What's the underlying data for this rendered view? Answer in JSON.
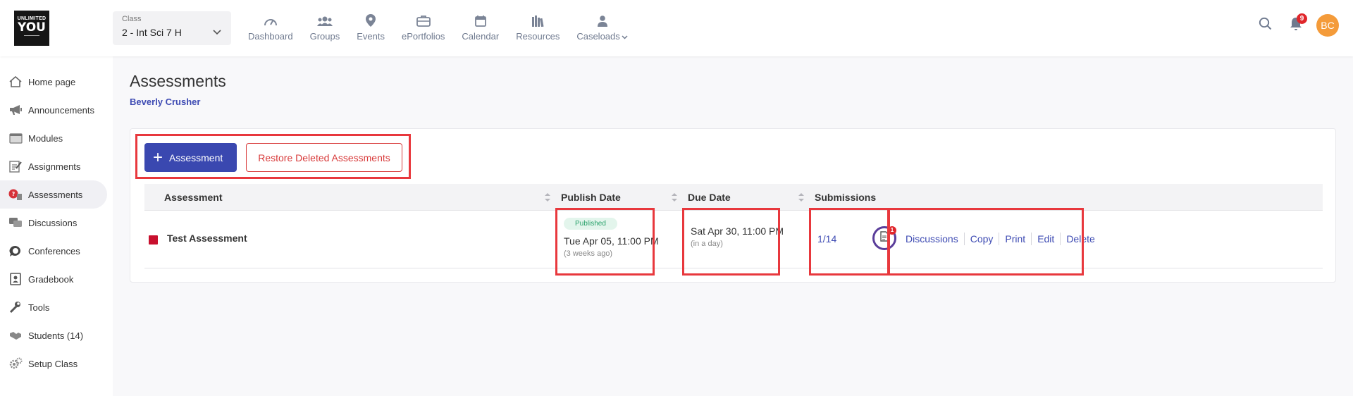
{
  "logo": {
    "line1": "UNLIMITED",
    "line2": "YOU"
  },
  "class_select": {
    "label": "Class",
    "value": "2 - Int Sci 7 H"
  },
  "topnav": [
    {
      "label": "Dashboard",
      "icon": "gauge-icon"
    },
    {
      "label": "Groups",
      "icon": "users-icon"
    },
    {
      "label": "Events",
      "icon": "map-pin-icon"
    },
    {
      "label": "ePortfolios",
      "icon": "briefcase-icon"
    },
    {
      "label": "Calendar",
      "icon": "calendar-icon"
    },
    {
      "label": "Resources",
      "icon": "books-icon"
    },
    {
      "label": "Caseloads",
      "icon": "person-icon"
    }
  ],
  "notifications": {
    "count": "9"
  },
  "user": {
    "initials": "BC"
  },
  "sidebar": [
    {
      "label": "Home page",
      "icon": "home-icon"
    },
    {
      "label": "Announcements",
      "icon": "megaphone-icon"
    },
    {
      "label": "Modules",
      "icon": "folder-icon"
    },
    {
      "label": "Assignments",
      "icon": "assignment-icon"
    },
    {
      "label": "Assessments",
      "icon": "assessment-icon",
      "active": true
    },
    {
      "label": "Discussions",
      "icon": "discussion-icon"
    },
    {
      "label": "Conferences",
      "icon": "chat-bubble-icon"
    },
    {
      "label": "Gradebook",
      "icon": "gradebook-icon"
    },
    {
      "label": "Tools",
      "icon": "wrench-icon"
    },
    {
      "label": "Students (14)",
      "icon": "handshake-icon"
    },
    {
      "label": "Setup Class",
      "icon": "gears-icon"
    }
  ],
  "page": {
    "title": "Assessments",
    "teacher": "Beverly Crusher"
  },
  "toolbar": {
    "add_label": "Assessment",
    "restore_label": "Restore Deleted Assessments"
  },
  "table": {
    "headers": {
      "assessment": "Assessment",
      "publish": "Publish Date",
      "due": "Due Date",
      "submissions": "Submissions"
    },
    "rows": [
      {
        "title": "Test Assessment",
        "color": "#c8102e",
        "status": "Published",
        "publish_date": "Tue Apr 05, 11:00 PM",
        "publish_relative": "(3 weeks ago)",
        "due_date": "Sat Apr 30, 11:00 PM",
        "due_relative": "(in a day)",
        "submissions": "1/14",
        "submission_badge": "1",
        "actions": [
          "Discussions",
          "Copy",
          "Print",
          "Edit",
          "Delete"
        ]
      }
    ]
  },
  "colors": {
    "primary": "#3a48b0",
    "danger": "#d83b3b",
    "avatar": "#f49b3a",
    "highlight": "#e8383d"
  }
}
